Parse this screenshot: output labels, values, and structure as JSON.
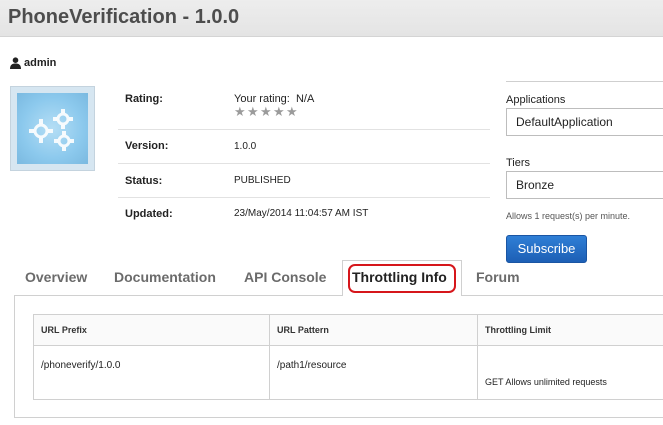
{
  "window": {
    "title": "PhoneVerification - 1.0.0"
  },
  "user": {
    "name": "admin",
    "icon": "user-icon"
  },
  "thumbnail": {
    "icon": "gears-icon"
  },
  "info": {
    "rating_label": "Rating:",
    "your_rating": "Your rating:",
    "rating_value": "N/A",
    "stars": 5,
    "stars_filled": 0,
    "version_label": "Version:",
    "version_value": "1.0.0",
    "status_label": "Status:",
    "status_value": "PUBLISHED",
    "updated_label": "Updated:",
    "updated_value": "23/May/2014 11:04:57 AM IST"
  },
  "subscription": {
    "applications_label": "Applications",
    "application_selected": "DefaultApplication",
    "tiers_label": "Tiers",
    "tier_selected": "Bronze",
    "tier_note": "Allows 1 request(s) per minute.",
    "subscribe_label": "Subscribe",
    "accent": "#1f67c2"
  },
  "tabs": [
    {
      "label": "Overview"
    },
    {
      "label": "Documentation"
    },
    {
      "label": "API Console"
    },
    {
      "label": "Throttling Info",
      "active": true
    },
    {
      "label": "Forum"
    }
  ],
  "throttling_table": {
    "headers": [
      "URL Prefix",
      "URL Pattern",
      "Throttling Limit"
    ],
    "rows": [
      {
        "prefix": "/phoneverify/1.0.0",
        "pattern": "/path1/resource",
        "limit": "GET Allows unlimited requests"
      }
    ]
  },
  "highlight_color": "#d6161b"
}
